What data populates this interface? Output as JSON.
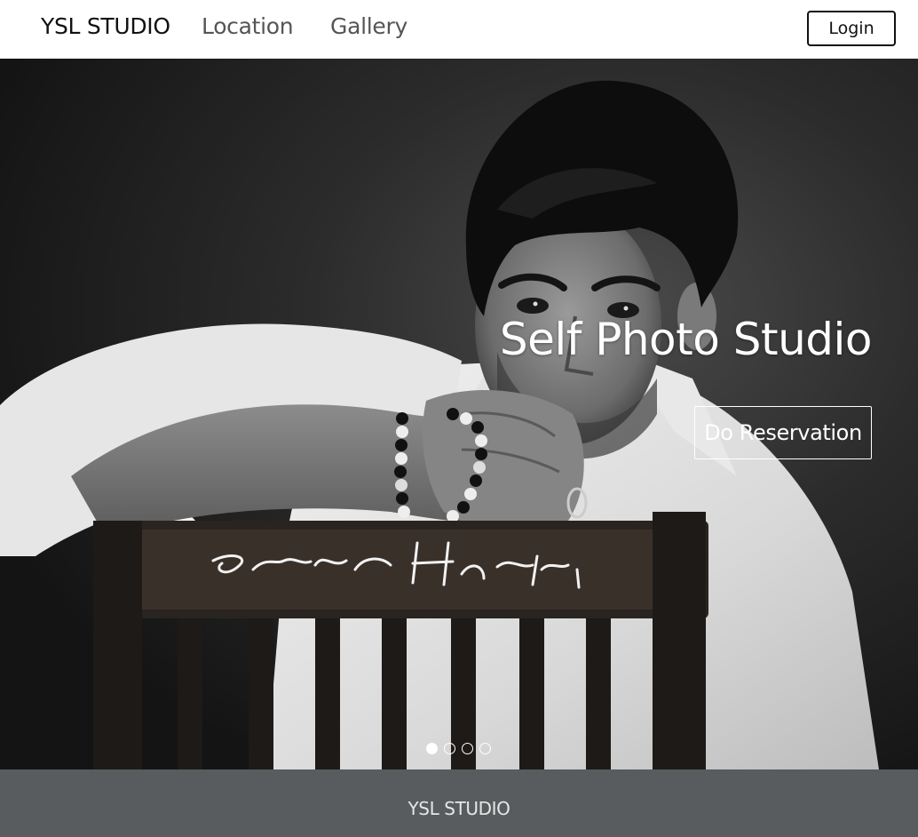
{
  "navbar": {
    "brand": "YSL STUDIO",
    "links": [
      {
        "label": "Location"
      },
      {
        "label": "Gallery"
      }
    ],
    "login_label": "Login"
  },
  "hero": {
    "title": "Self Photo Studio",
    "cta_label": "Do Reservation",
    "photo": {
      "signature_text": "Emran Hashmi"
    },
    "slides": {
      "count": 4,
      "active_index": 0
    }
  },
  "footer": {
    "text": "YSL STUDIO",
    "background": "#585c5f"
  },
  "colors": {
    "navbar_bg": "#ffffff",
    "text_dark": "#111111",
    "nav_link": "#555555",
    "hero_text": "#ffffff"
  },
  "icons": [
    "carousel-indicator-dot"
  ]
}
